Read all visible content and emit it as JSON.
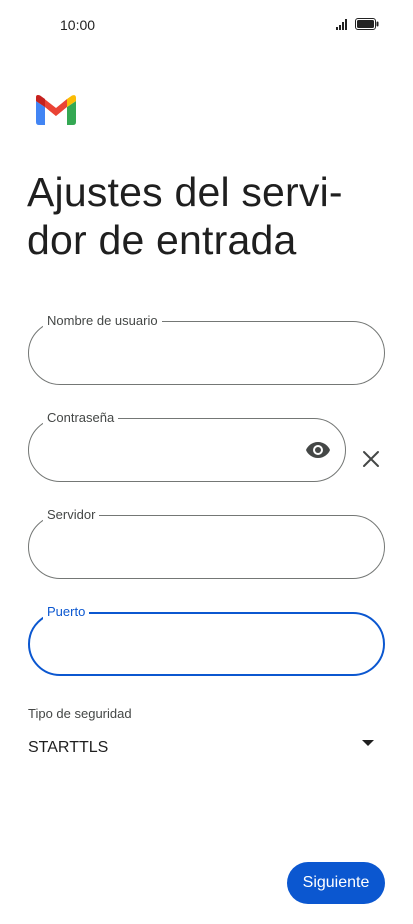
{
  "status_bar": {
    "time": "10:00"
  },
  "app": {
    "logo_icon": "gmail-logo-icon"
  },
  "page": {
    "title": "Ajustes del servi-dor de entrada"
  },
  "form": {
    "username": {
      "label": "Nombre de usuario",
      "value": ""
    },
    "password": {
      "label": "Contraseña",
      "value": "",
      "toggle_icon": "eye-icon",
      "clear_icon": "close-icon"
    },
    "server": {
      "label": "Servidor",
      "value": ""
    },
    "port": {
      "label": "Puerto",
      "value": ""
    },
    "security": {
      "label": "Tipo de seguridad",
      "selected": "STARTTLS"
    }
  },
  "actions": {
    "next_label": "Siguiente"
  },
  "colors": {
    "accent": "#0b57d0",
    "outline": "#747775",
    "text": "#1f1f1f"
  }
}
